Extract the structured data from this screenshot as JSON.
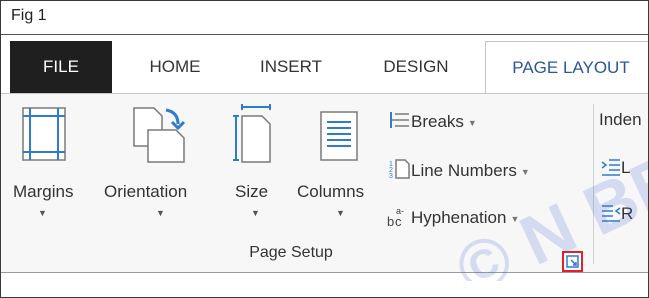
{
  "figure": {
    "label": "Fig 1"
  },
  "tabs": {
    "file": "FILE",
    "home": "HOME",
    "insert": "INSERT",
    "design": "DESIGN",
    "page_layout": "PAGE LAYOUT"
  },
  "page_setup": {
    "margins": "Margins",
    "orientation": "Orientation",
    "size": "Size",
    "columns": "Columns",
    "breaks": "Breaks",
    "line_numbers": "Line Numbers",
    "hyphenation": "Hyphenation",
    "group_label": "Page Setup"
  },
  "paragraph": {
    "indent_label": "Inden",
    "left_label": "L",
    "right_label": "R"
  },
  "watermark": {
    "text": "© N BE"
  },
  "colors": {
    "file_tab_bg": "#1f1f1f",
    "active_tab_text": "#2b579a",
    "launcher_highlight": "#e0202a",
    "icon_blue": "#2f7ccf"
  },
  "icons": {
    "margins": "margins-icon",
    "orientation": "orientation-icon",
    "size": "size-icon",
    "columns": "columns-icon",
    "breaks": "breaks-icon",
    "line_numbers": "line-numbers-icon",
    "hyphenation": "hyphenation-icon",
    "indent_left": "indent-left-icon",
    "indent_right": "indent-right-icon",
    "dialog_launcher": "dialog-launcher-icon"
  }
}
